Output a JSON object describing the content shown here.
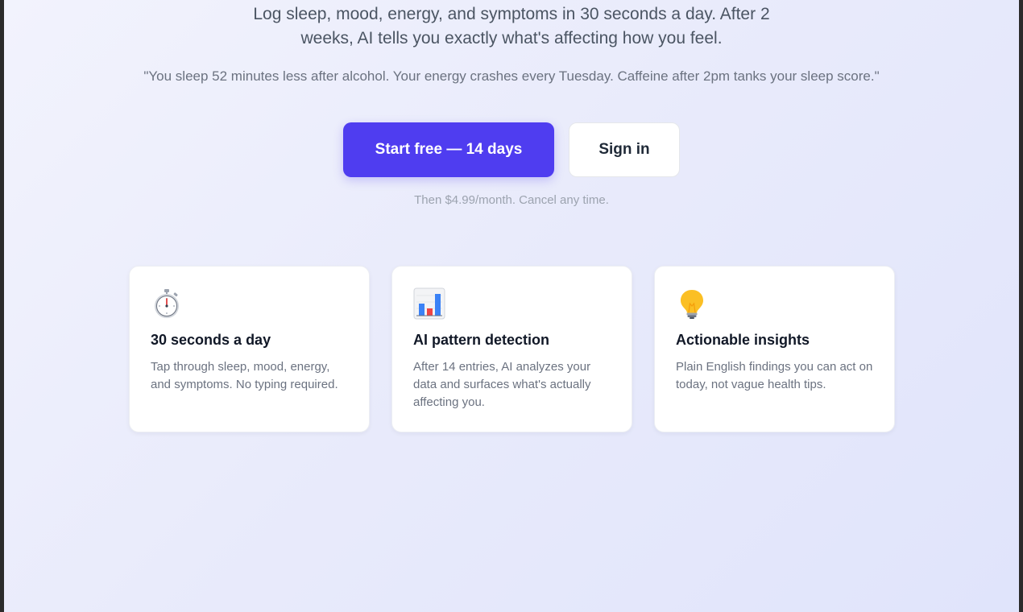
{
  "hero": {
    "subtitle_line1": "Log sleep, mood, energy, and symptoms in 30 seconds a day. After 2",
    "subtitle_line2": "weeks, AI tells you exactly what's affecting how you feel.",
    "quote": "\"You sleep 52 minutes less after alcohol. Your energy crashes every Tuesday. Caffeine after 2pm tanks your sleep score.\""
  },
  "cta": {
    "primary_label": "Start free — 14 days",
    "secondary_label": "Sign in",
    "price_note": "Then $4.99/month. Cancel any time."
  },
  "features": [
    {
      "icon": "stopwatch-icon",
      "title": "30 seconds a day",
      "body": "Tap through sleep, mood, energy, and symptoms. No typing required."
    },
    {
      "icon": "bar-chart-icon",
      "title": "AI pattern detection",
      "body": "After 14 entries, AI analyzes your data and surfaces what's actually affecting you."
    },
    {
      "icon": "light-bulb-icon",
      "title": "Actionable insights",
      "body": "Plain English findings you can act on today, not vague health tips."
    }
  ],
  "colors": {
    "primary": "#4f3df0",
    "text_dark": "#111827",
    "text_muted": "#6b7280",
    "background": "#eceefc"
  }
}
